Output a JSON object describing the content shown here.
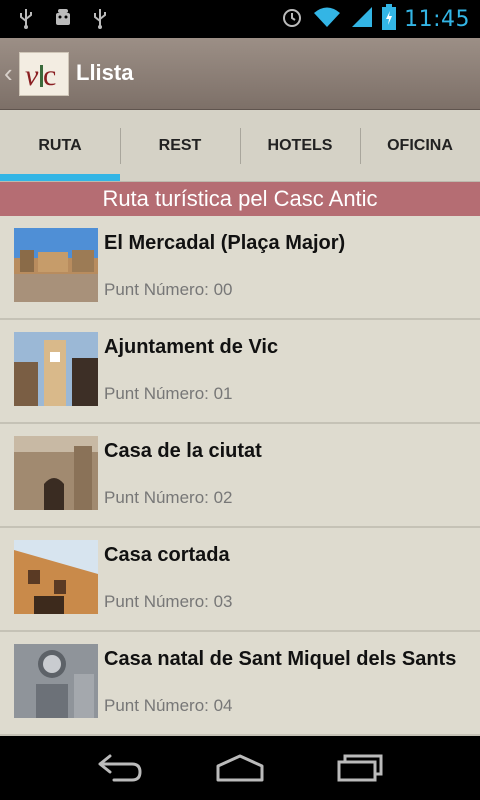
{
  "status": {
    "time": "11:45"
  },
  "action_bar": {
    "logo_text": "vic",
    "title": "Llista"
  },
  "tabs": [
    {
      "label": "RUTA",
      "active": true
    },
    {
      "label": "REST"
    },
    {
      "label": "HOTELS"
    },
    {
      "label": "OFICINA"
    }
  ],
  "section_header": "Ruta turística pel Casc Antic",
  "items": [
    {
      "title": "El Mercadal (Plaça Major)",
      "subtitle": "Punt Número: 00"
    },
    {
      "title": "Ajuntament de Vic",
      "subtitle": "Punt Número: 01"
    },
    {
      "title": "Casa de la ciutat",
      "subtitle": "Punt Número: 02"
    },
    {
      "title": "Casa cortada",
      "subtitle": "Punt Número: 03"
    },
    {
      "title": "Casa natal de Sant Miquel dels Sants",
      "subtitle": "Punt Número: 04"
    }
  ],
  "colors": {
    "accent": "#33b5e5",
    "section_header": "#b56d73",
    "list_bg": "#dedbcf"
  }
}
